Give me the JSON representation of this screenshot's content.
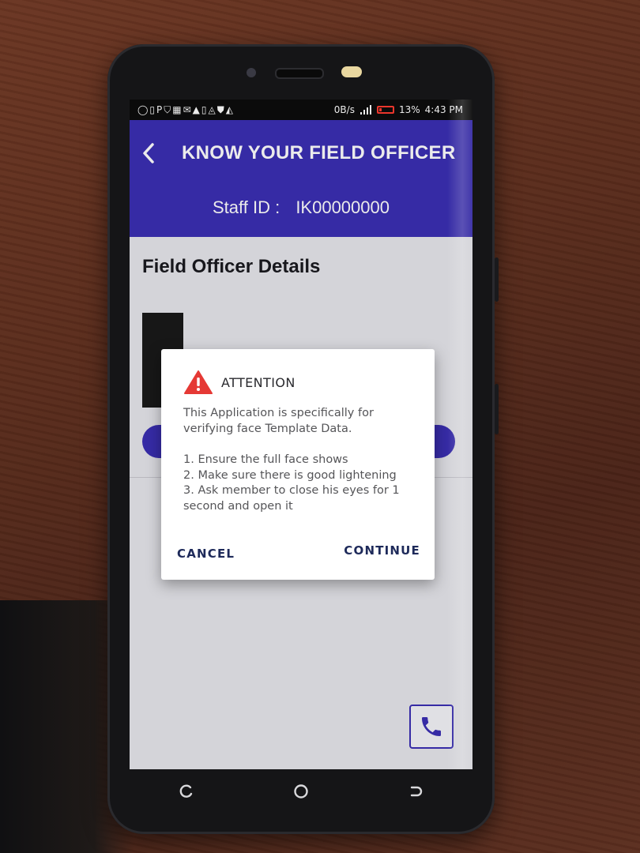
{
  "status_bar": {
    "notification_icons": "◯▯P⛉▦✉▲▯◬⛊◭",
    "network_speed": "0B/s",
    "battery_percent": "13%",
    "time": "4:43 PM"
  },
  "header": {
    "title": "KNOW YOUR FIELD OFFICER",
    "staff_label": "Staff ID :",
    "staff_id": "IK00000000"
  },
  "main": {
    "section_title": "Field Officer Details"
  },
  "dialog": {
    "title": "ATTENTION",
    "line1": "This Application is specifically for verifying face Template Data.",
    "item1": "1. Ensure the full face shows",
    "item2": "2. Make sure there is good lightening",
    "item3": "3. Ask member to close his eyes for 1 second and open it",
    "cancel_label": "CANCEL",
    "continue_label": "CONTINUE"
  },
  "colors": {
    "primary": "#3b2fb3",
    "dialog_button": "#1e2a5a",
    "warning": "#e53935"
  },
  "icons": {
    "back": "chevron-left-icon",
    "warning": "warning-triangle-icon",
    "call": "phone-icon",
    "nav_recent": "recent-apps-icon",
    "nav_home": "home-icon",
    "nav_back": "back-icon"
  }
}
